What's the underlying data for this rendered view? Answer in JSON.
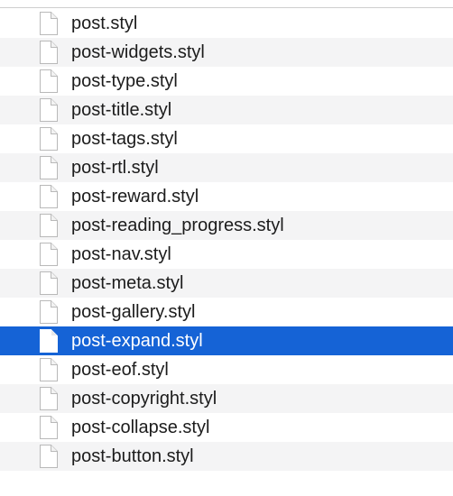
{
  "files": [
    {
      "name": "post.styl",
      "selected": false
    },
    {
      "name": "post-widgets.styl",
      "selected": false
    },
    {
      "name": "post-type.styl",
      "selected": false
    },
    {
      "name": "post-title.styl",
      "selected": false
    },
    {
      "name": "post-tags.styl",
      "selected": false
    },
    {
      "name": "post-rtl.styl",
      "selected": false
    },
    {
      "name": "post-reward.styl",
      "selected": false
    },
    {
      "name": "post-reading_progress.styl",
      "selected": false
    },
    {
      "name": "post-nav.styl",
      "selected": false
    },
    {
      "name": "post-meta.styl",
      "selected": false
    },
    {
      "name": "post-gallery.styl",
      "selected": false
    },
    {
      "name": "post-expand.styl",
      "selected": true
    },
    {
      "name": "post-eof.styl",
      "selected": false
    },
    {
      "name": "post-copyright.styl",
      "selected": false
    },
    {
      "name": "post-collapse.styl",
      "selected": false
    },
    {
      "name": "post-button.styl",
      "selected": false
    }
  ],
  "icon": "document-icon",
  "colors": {
    "selection": "#1563d6",
    "stripe": "#f4f4f5",
    "text": "#1c1c1c"
  }
}
